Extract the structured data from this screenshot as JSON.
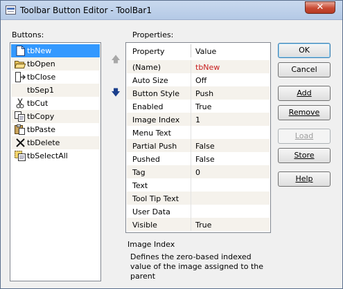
{
  "window": {
    "title": "Toolbar Button Editor - ToolBar1",
    "close_glyph": "✕"
  },
  "buttons_panel": {
    "label": "Buttons:",
    "items": [
      {
        "label": "tbNew",
        "icon": "new-file-icon",
        "selected": true
      },
      {
        "label": "tbOpen",
        "icon": "open-folder-icon"
      },
      {
        "label": "tbClose",
        "icon": "close-doc-icon"
      },
      {
        "label": "tbSep1",
        "icon": "none"
      },
      {
        "label": "tbCut",
        "icon": "scissors-icon"
      },
      {
        "label": "tbCopy",
        "icon": "copy-icon"
      },
      {
        "label": "tbPaste",
        "icon": "paste-icon"
      },
      {
        "label": "tbDelete",
        "icon": "delete-x-icon"
      },
      {
        "label": "tbSelectAll",
        "icon": "select-all-icon"
      }
    ],
    "move_up_glyph": "🡅",
    "move_down_glyph": "🡇"
  },
  "properties_panel": {
    "label": "Properties:",
    "header": {
      "property": "Property",
      "value": "Value"
    },
    "rows": [
      {
        "name": "(Name)",
        "value": "tbNew"
      },
      {
        "name": "Auto Size",
        "value": "Off"
      },
      {
        "name": "Button Style",
        "value": "Push"
      },
      {
        "name": "Enabled",
        "value": "True"
      },
      {
        "name": "Image Index",
        "value": "1"
      },
      {
        "name": "Menu Text",
        "value": ""
      },
      {
        "name": "Partial Push",
        "value": "False"
      },
      {
        "name": "Pushed",
        "value": "False"
      },
      {
        "name": "Tag",
        "value": "0"
      },
      {
        "name": "Text",
        "value": ""
      },
      {
        "name": "Tool Tip Text",
        "value": ""
      },
      {
        "name": "User Data",
        "value": ""
      },
      {
        "name": "Visible",
        "value": "True"
      }
    ],
    "description": {
      "title": "Image Index",
      "text": "Defines the zero-based indexed value of the image assigned to the parent"
    }
  },
  "actions": {
    "ok": "OK",
    "cancel": "Cancel",
    "add": "Add",
    "remove": "Remove",
    "load": "Load",
    "store": "Store",
    "help": "Help"
  },
  "colors": {
    "selection": "#3399ff",
    "name_value": "#c81e1e",
    "alt_row": "#f5f2ec"
  }
}
